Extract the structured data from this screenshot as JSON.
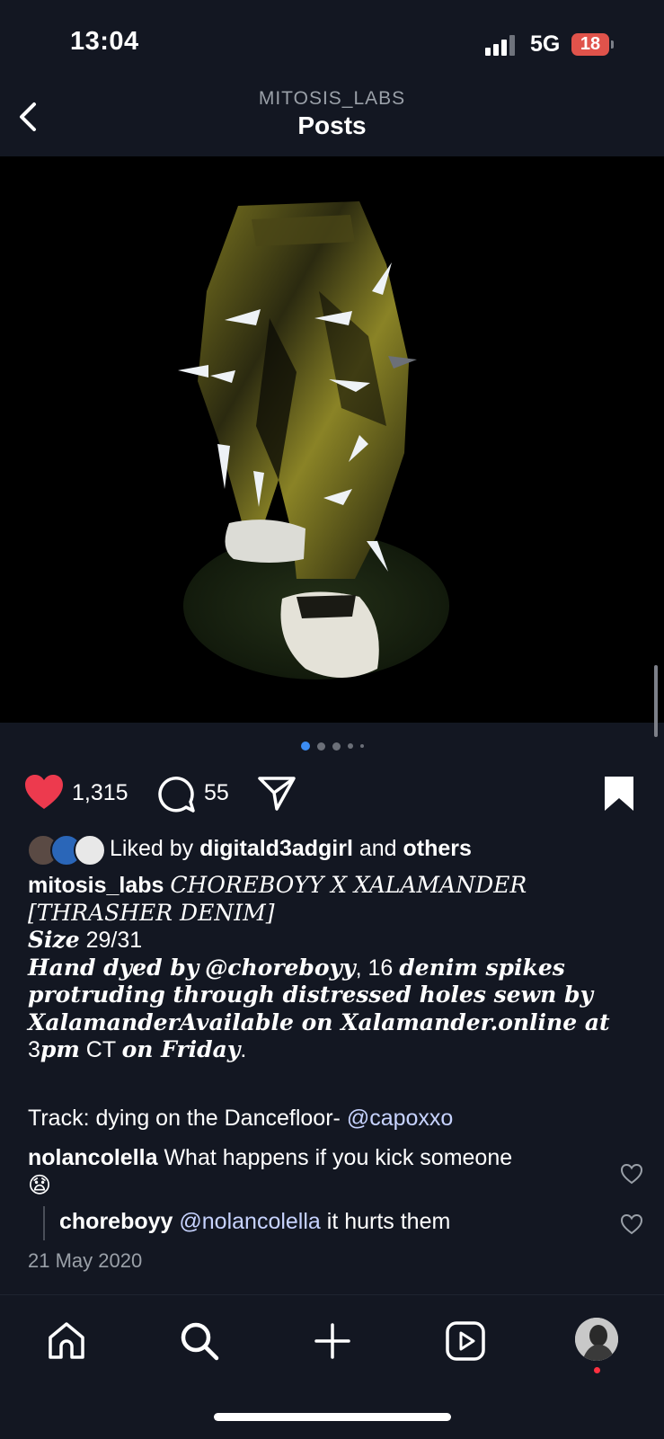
{
  "status_bar": {
    "time": "13:04",
    "network": "5G",
    "battery": "18"
  },
  "header": {
    "account": "MITOSIS_LABS",
    "title": "Posts"
  },
  "post": {
    "likes": "1,315",
    "comments": "55",
    "carousel": {
      "count": 5,
      "active_index": 0
    },
    "liked_by": {
      "prefix": "Liked by ",
      "user": "digitald3adgirl",
      "middle": " and ",
      "others": "others"
    },
    "caption": {
      "username": "mitosis_labs",
      "line1": "CHOREBOYY X XALAMANDER",
      "line2": "[THRASHER DENIM]",
      "size_label": "Size",
      "size_value": "29/31",
      "desc_a": "Hand dyed by",
      "desc_mention": "@choreboyy",
      "desc_b": ", 16",
      "desc_c": "denim spikes protruding through distressed holes sewn by XalamanderAvailable on Xalamander.online at",
      "desc_d": "3",
      "desc_e": "pm",
      "desc_f": "CT",
      "desc_g": "on Friday",
      "desc_h": "."
    },
    "track": {
      "label": "Track: dying on the Dancefloor- ",
      "mention": "@capoxxo"
    },
    "comments_list": [
      {
        "user": "nolancolella",
        "text": "What happens if you kick someone",
        "emoji": "😧"
      },
      {
        "user": "choreboyy",
        "mention": "@nolancolella",
        "text": " it hurts them"
      }
    ],
    "date": "21 May 2020"
  },
  "colors": {
    "accent_blue": "#3b8cf3",
    "like_red": "#ed3a4e",
    "background": "#131722"
  },
  "tabbar": {
    "icons": [
      "home-icon",
      "search-icon",
      "create-icon",
      "reels-icon",
      "profile-avatar"
    ]
  }
}
